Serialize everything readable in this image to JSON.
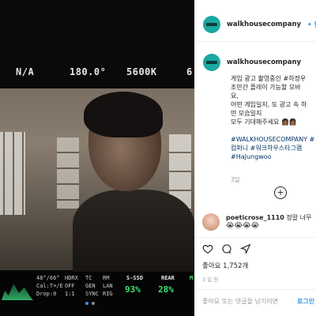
{
  "monitor": {
    "top": {
      "iris": "N/A",
      "shutter": "180.0°",
      "wb": "5600K",
      "extra": "6"
    },
    "bottom": {
      "angle": "48°/66°",
      "cal": "Cal:T+/E",
      "drop": "Drop:0",
      "hdrx": "HDRX",
      "hdrx_val": "OFF",
      "tc": "TC",
      "tc_val": "GEN",
      "rm": "RM",
      "rm_val": "LAN",
      "ratio": "1:1",
      "sync": "SYNC",
      "rig": "RIG",
      "ssd_label": "S-SSD",
      "ssd_val": "93%",
      "rear_label": "REAR",
      "rear_val": "28%",
      "m": "M"
    }
  },
  "post": {
    "username": "walkhousecompany",
    "follow": "• 팔로우",
    "caption": [
      "게임 광고 촬영중인 #하정우",
      "조만간 플레이 가능할 모바",
      "요,",
      "어떤 게임일지, 또 광고 속 하",
      "떤 모습일지",
      "모두 기대해주세요 👩🏾👩🏾"
    ],
    "hashtags": [
      "#WALKHOUSECOMPANY #",
      "컴퍼니 #워크하우스타그램",
      "#HaJungwoo"
    ],
    "time_ago": "3일",
    "comment": {
      "user": "poeticrose_1110",
      "text": "정말 너무",
      "emojis": "😭😭😭😭"
    },
    "likes": "좋아요 1,752개",
    "posted": "3 일 전",
    "comment_placeholder": "좋아요 또는 댓글을 남기려면",
    "login": "로그인"
  }
}
